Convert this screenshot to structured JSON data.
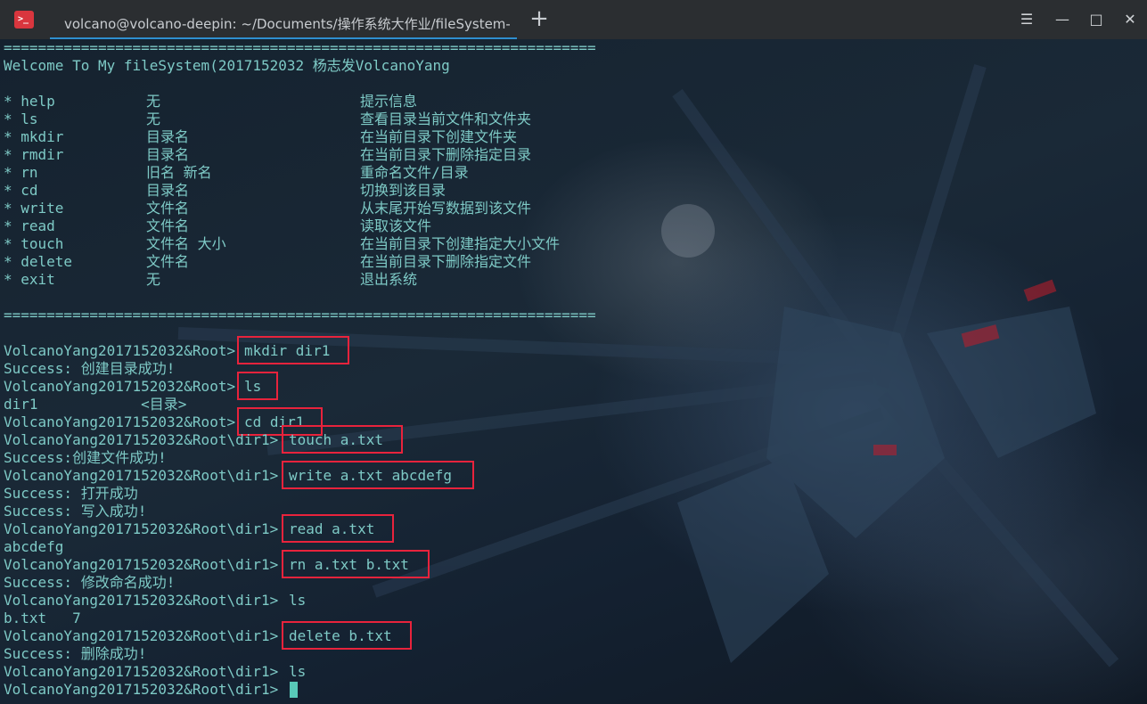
{
  "window": {
    "title": "volcano@volcano-deepin: ~/Documents/操作系统大作业/fileSystem-szu",
    "app_icon_text": ">_",
    "new_tab_label": "+",
    "controls": {
      "menu": "☰",
      "minimize": "—",
      "maximize": "□",
      "close": "✕"
    }
  },
  "terminal": {
    "separator_top": "=====================================================================",
    "welcome": "Welcome To My fileSystem(2017152032 杨志发VolcanoYang",
    "help_rows": [
      {
        "cmd": "* help",
        "arg": "无",
        "desc": "提示信息"
      },
      {
        "cmd": "* ls",
        "arg": "无",
        "desc": "查看目录当前文件和文件夹"
      },
      {
        "cmd": "* mkdir",
        "arg": "目录名",
        "desc": "在当前目录下创建文件夹"
      },
      {
        "cmd": "* rmdir",
        "arg": "目录名",
        "desc": "在当前目录下删除指定目录"
      },
      {
        "cmd": "* rn",
        "arg": "旧名 新名",
        "desc": "重命名文件/目录"
      },
      {
        "cmd": "* cd",
        "arg": "目录名",
        "desc": "切换到该目录"
      },
      {
        "cmd": "* write",
        "arg": "文件名",
        "desc": "从末尾开始写数据到该文件"
      },
      {
        "cmd": "* read",
        "arg": "文件名",
        "desc": "读取该文件"
      },
      {
        "cmd": "* touch",
        "arg": "文件名 大小",
        "desc": "在当前目录下创建指定大小文件"
      },
      {
        "cmd": "* delete",
        "arg": "文件名",
        "desc": "在当前目录下删除指定文件"
      },
      {
        "cmd": "* exit",
        "arg": "无",
        "desc": "退出系统"
      }
    ],
    "separator_bottom": "=====================================================================",
    "session": [
      {
        "prompt": "VolcanoYang2017152032&Root>",
        "input": "mkdir dir1"
      },
      {
        "output": "Success: 创建目录成功!"
      },
      {
        "prompt": "VolcanoYang2017152032&Root>",
        "input": "ls"
      },
      {
        "output": "dir1            <目录>"
      },
      {
        "prompt": "VolcanoYang2017152032&Root>",
        "input": "cd dir1"
      },
      {
        "prompt": "VolcanoYang2017152032&Root\\dir1>",
        "input": "touch a.txt"
      },
      {
        "output": "Success:创建文件成功!"
      },
      {
        "prompt": "VolcanoYang2017152032&Root\\dir1>",
        "input": "write a.txt abcdefg"
      },
      {
        "output": "Success: 打开成功"
      },
      {
        "output": "Success: 写入成功!"
      },
      {
        "prompt": "VolcanoYang2017152032&Root\\dir1>",
        "input": "read a.txt"
      },
      {
        "output": "abcdefg"
      },
      {
        "prompt": "VolcanoYang2017152032&Root\\dir1>",
        "input": "rn a.txt b.txt"
      },
      {
        "output": "Success: 修改命名成功!"
      },
      {
        "prompt": "VolcanoYang2017152032&Root\\dir1>",
        "input": "ls"
      },
      {
        "output": "b.txt   7"
      },
      {
        "prompt": "VolcanoYang2017152032&Root\\dir1>",
        "input": "delete b.txt"
      },
      {
        "output": "Success: 删除成功!"
      },
      {
        "prompt": "VolcanoYang2017152032&Root\\dir1>",
        "input": "ls"
      },
      {
        "prompt": "VolcanoYang2017152032&Root\\dir1>",
        "input": ""
      }
    ]
  },
  "colors": {
    "text": "#7ecac6",
    "highlight_box": "#e8233c",
    "cursor": "#58c9b8",
    "tab_underline": "#2f8fd0",
    "app_icon": "#d9363e"
  }
}
